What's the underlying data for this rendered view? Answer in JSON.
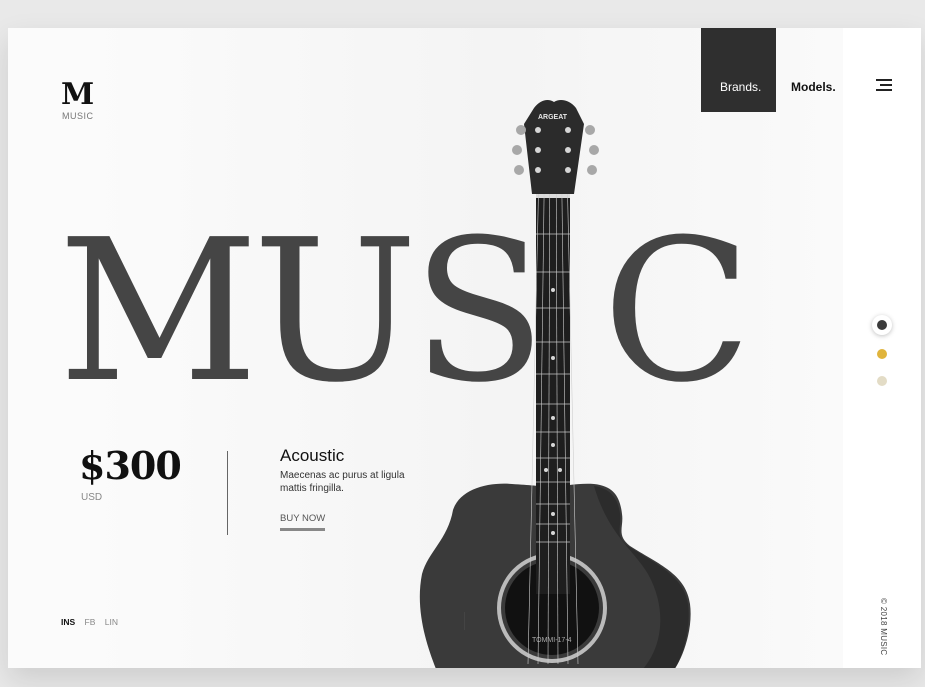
{
  "brand": {
    "mark": "M",
    "name": "MUSIC"
  },
  "nav": {
    "brands": "Brands.",
    "models": "Models."
  },
  "hero": {
    "word_left": "MUS",
    "word_i": "I",
    "word_right": "C"
  },
  "guitar": {
    "headstock_text": "ARGEAT",
    "soundhole_text": "TOMMI-17-4"
  },
  "product": {
    "price": "$300",
    "currency": "USD",
    "title": "Acoustic",
    "description": "Maecenas ac purus at ligula mattis fringilla.",
    "cta": "BUY NOW"
  },
  "social": {
    "items": [
      "INS",
      "FB",
      "LIN"
    ]
  },
  "footer": {
    "copyright": "© 2018 MUSIC"
  },
  "colors": {
    "accent_dark": "#2f2f2f",
    "dot_active": "#3b3b3b",
    "dot_gold": "#e0b43c",
    "dot_beige": "#e3dcc6"
  },
  "icons": [
    "menu-icon",
    "guitar-image"
  ]
}
